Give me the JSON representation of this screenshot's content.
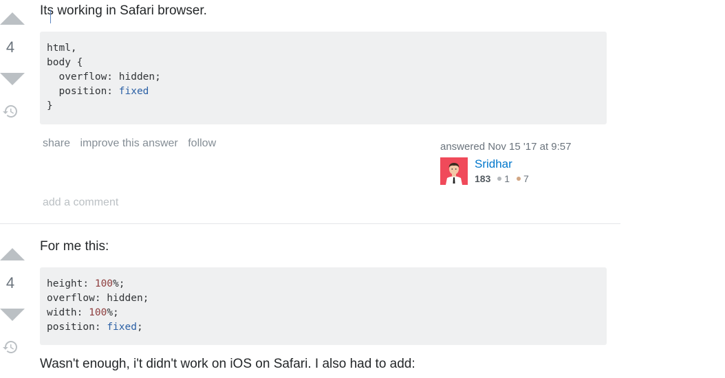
{
  "answers": [
    {
      "votes": "4",
      "text": "Its working in Safari browser.",
      "menu": {
        "share": "share",
        "improve": "improve this answer",
        "follow": "follow"
      },
      "signature": {
        "action": "answered Nov 15 '17 at 9:57",
        "user": "Sridhar",
        "reputation": "183",
        "silver": "1",
        "bronze": "7"
      },
      "add_comment": "add a comment"
    },
    {
      "votes": "4",
      "text": "For me this:",
      "after_text": "Wasn't enough, i't didn't work on iOS on Safari. I also had to add:"
    }
  ],
  "colors": {
    "link": "#0077cc",
    "muted": "#848d95",
    "code_background": "#eff0f1",
    "avatar_background": "#f04a5a"
  },
  "icons": [
    "arrow-up-icon",
    "arrow-down-icon",
    "history-icon"
  ]
}
